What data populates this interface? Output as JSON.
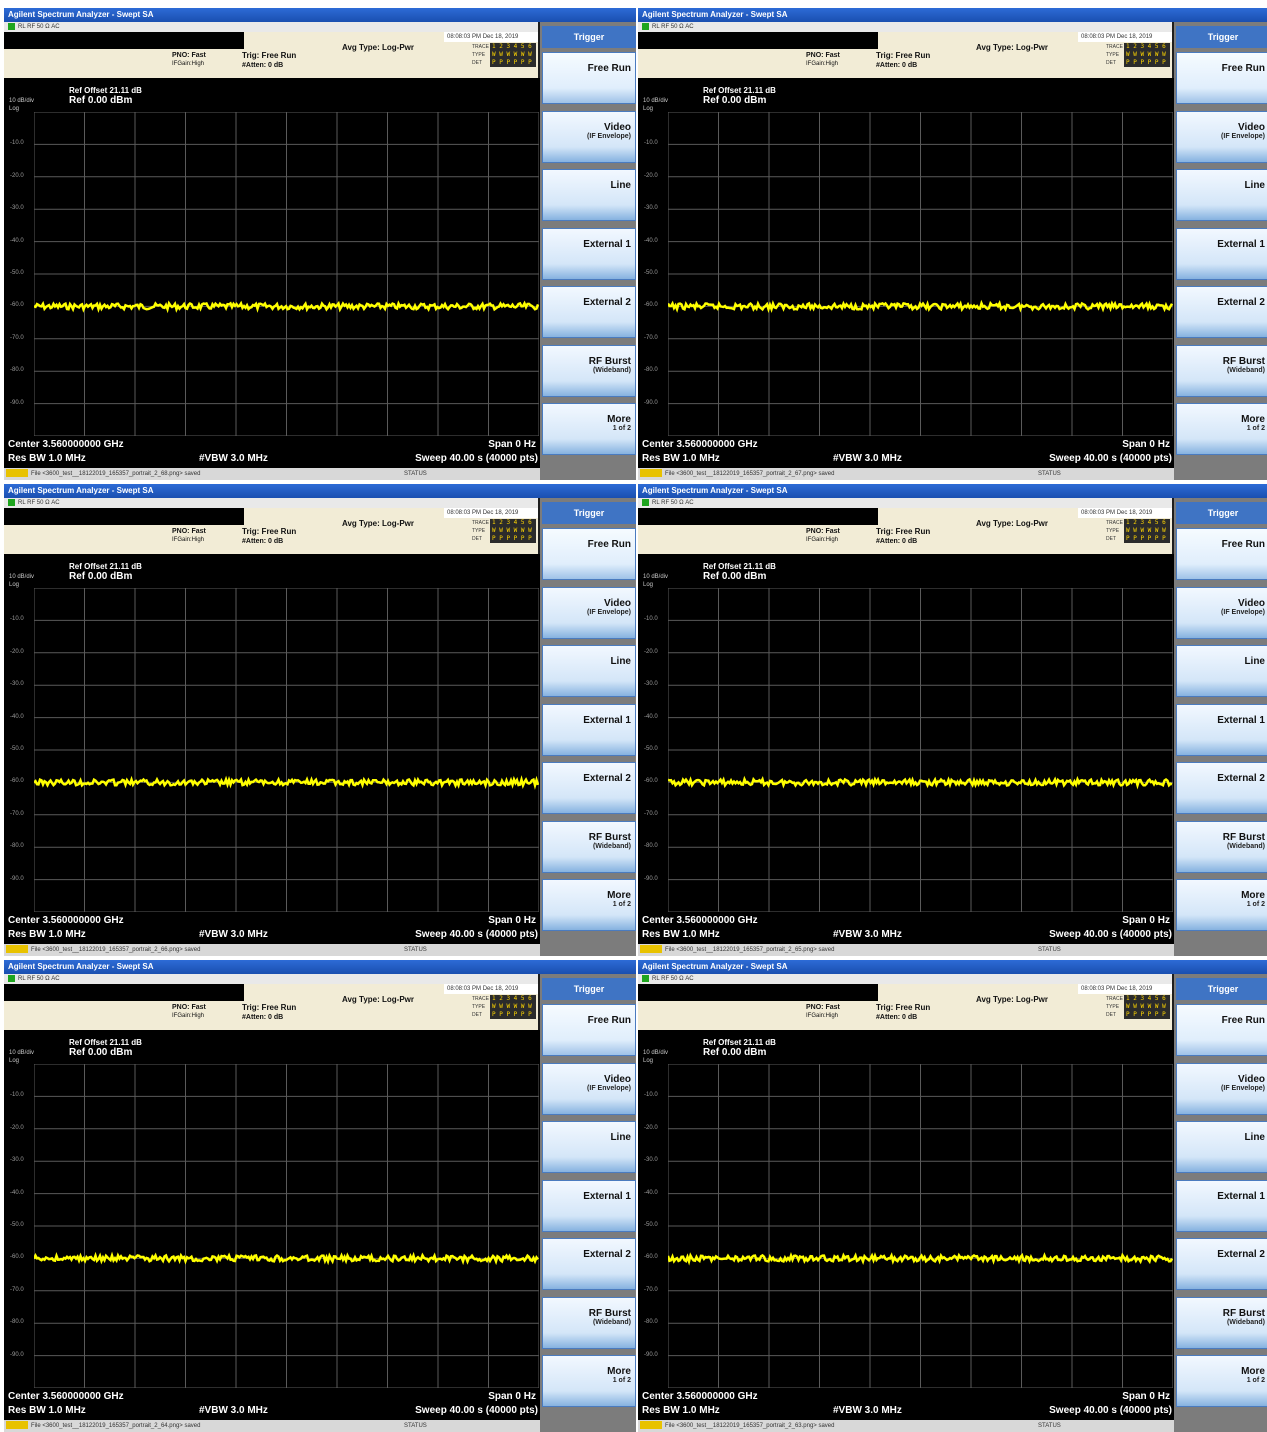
{
  "panels": [
    {
      "file_msg": "File <3600_test__18122019_165357_portrait_2_68.png> saved"
    },
    {
      "file_msg": "File <3600_test__18122019_165357_portrait_2_67.png> saved"
    },
    {
      "file_msg": "File <3600_test__18122019_165357_portrait_2_66.png> saved"
    },
    {
      "file_msg": "File <3600_test__18122019_165357_portrait_2_65.png> saved"
    },
    {
      "file_msg": "File <3600_test__18122019_165357_portrait_2_64.png> saved"
    },
    {
      "file_msg": "File <3600_test__18122019_165357_portrait_2_63.png> saved"
    }
  ],
  "common": {
    "window_title": "Agilent Spectrum Analyzer - Swept SA",
    "status_left": "RL      RF     50 Ω  AC",
    "date": "08:08:03 PM Dec 18, 2019",
    "pno": "PNO: Fast",
    "ifgain": "IFGain:High",
    "trig": "Trig: Free Run",
    "atten": "#Atten: 0 dB",
    "avg_type": "Avg Type: Log-Pwr",
    "trace_labels": [
      "TRACE",
      "TYPE",
      "DET"
    ],
    "trace_values": [
      "1 2 3 4 5 6",
      "W W W W W W",
      "P P P P P P"
    ],
    "ref_offset": "Ref Offset 21.11 dB",
    "ref_level": "Ref 0.00 dBm",
    "scale": "10 dB/div",
    "scale_type": "Log",
    "y_ticks": [
      "-10.0",
      "-20.0",
      "-30.0",
      "-40.0",
      "-50.0",
      "-60.0",
      "-70.0",
      "-80.0",
      "-90.0"
    ],
    "center": "Center 3.560000000 GHz",
    "span": "Span 0 Hz",
    "res_bw": "Res BW 1.0 MHz",
    "vbw": "#VBW 3.0 MHz",
    "sweep": "Sweep  40.00 s (40000 pts)",
    "msg_label": "MSG",
    "status_label": "STATUS",
    "menu_title": "Trigger",
    "softkeys": [
      {
        "label": "Free Run",
        "sub": ""
      },
      {
        "label": "Video",
        "sub": "(IF Envelope)"
      },
      {
        "label": "Line",
        "sub": ""
      },
      {
        "label": "External 1",
        "sub": ""
      },
      {
        "label": "External 2",
        "sub": ""
      },
      {
        "label": "RF Burst",
        "sub": "(Wideband)"
      },
      {
        "label": "More",
        "sub": "1 of 2"
      }
    ],
    "trace_color": "#ffff00",
    "trace_level_dbm": -60
  }
}
